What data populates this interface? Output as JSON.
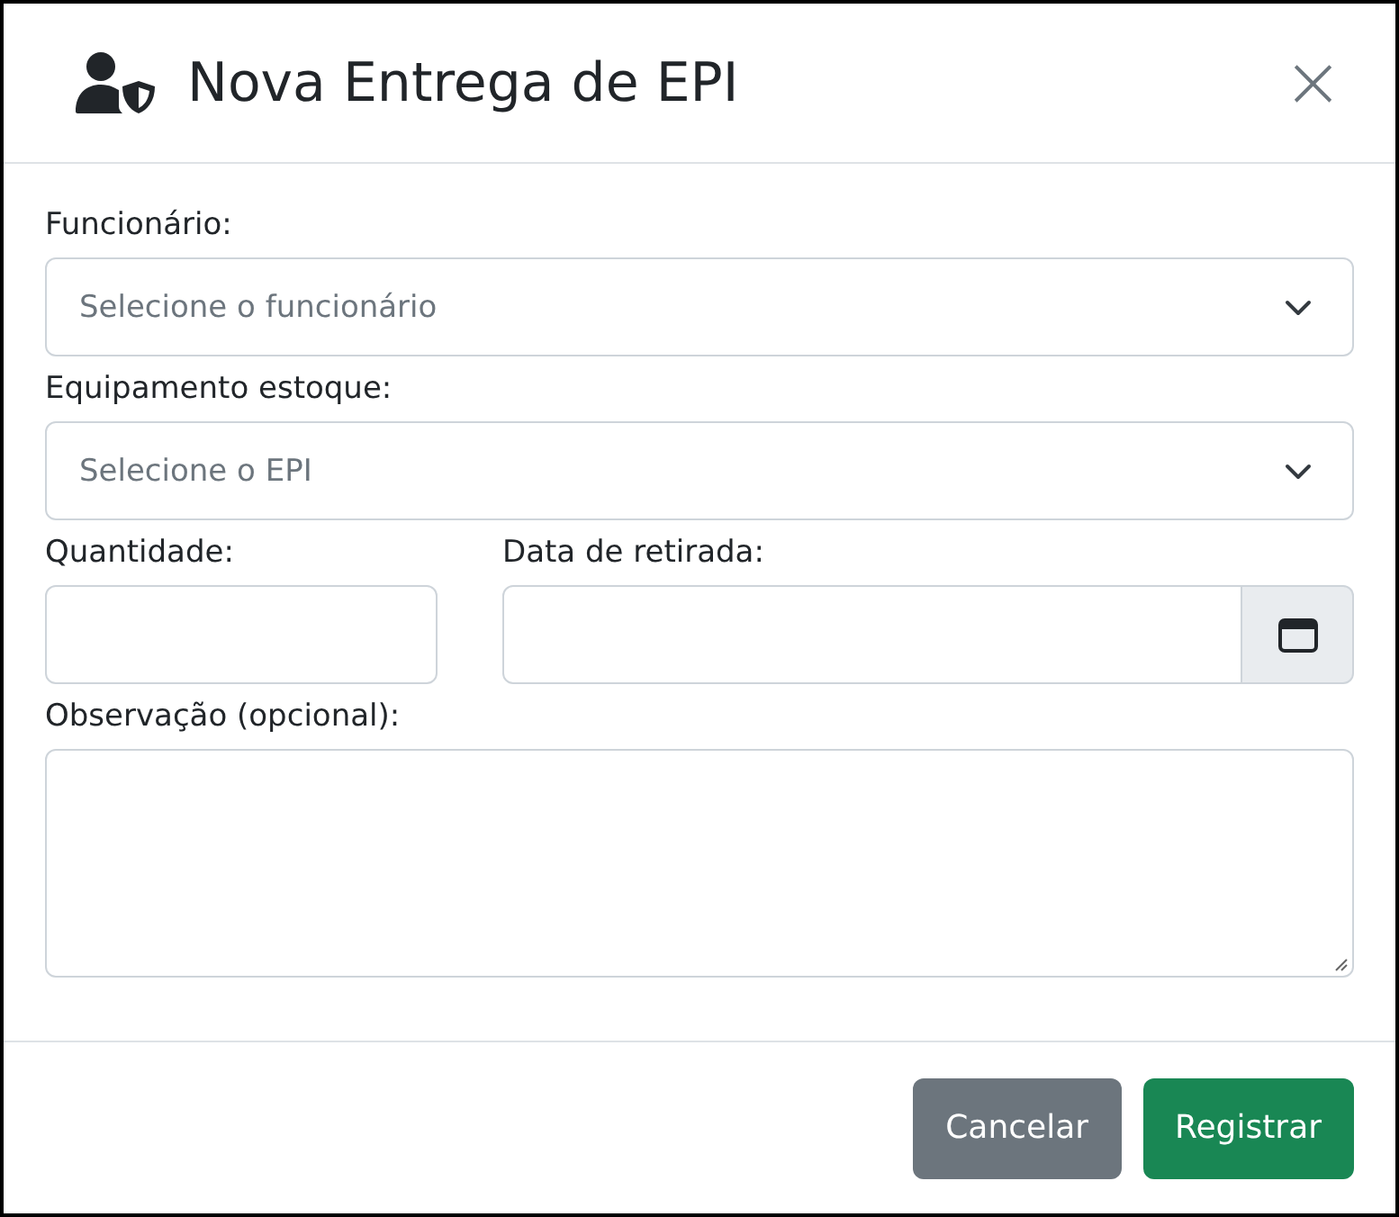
{
  "dialog": {
    "title": "Nova Entrega de EPI",
    "close": "×"
  },
  "fields": [
    {
      "kind": "select",
      "label": "Funcionário:",
      "placeholder": "Selecione o funcionário"
    },
    {
      "kind": "select",
      "label": "Equipamento estoque:",
      "placeholder": "Selecione o EPI"
    },
    {
      "kind": "pair",
      "items": [
        {
          "kind": "text",
          "label": "Quantidade:"
        },
        {
          "kind": "date",
          "label": "Data de retirada:"
        }
      ]
    },
    {
      "kind": "textarea",
      "label": "Observação (opcional):"
    }
  ],
  "buttons": [
    {
      "kind": "secondary",
      "label": "Cancelar"
    },
    {
      "kind": "success",
      "label": "Registrar"
    }
  ]
}
